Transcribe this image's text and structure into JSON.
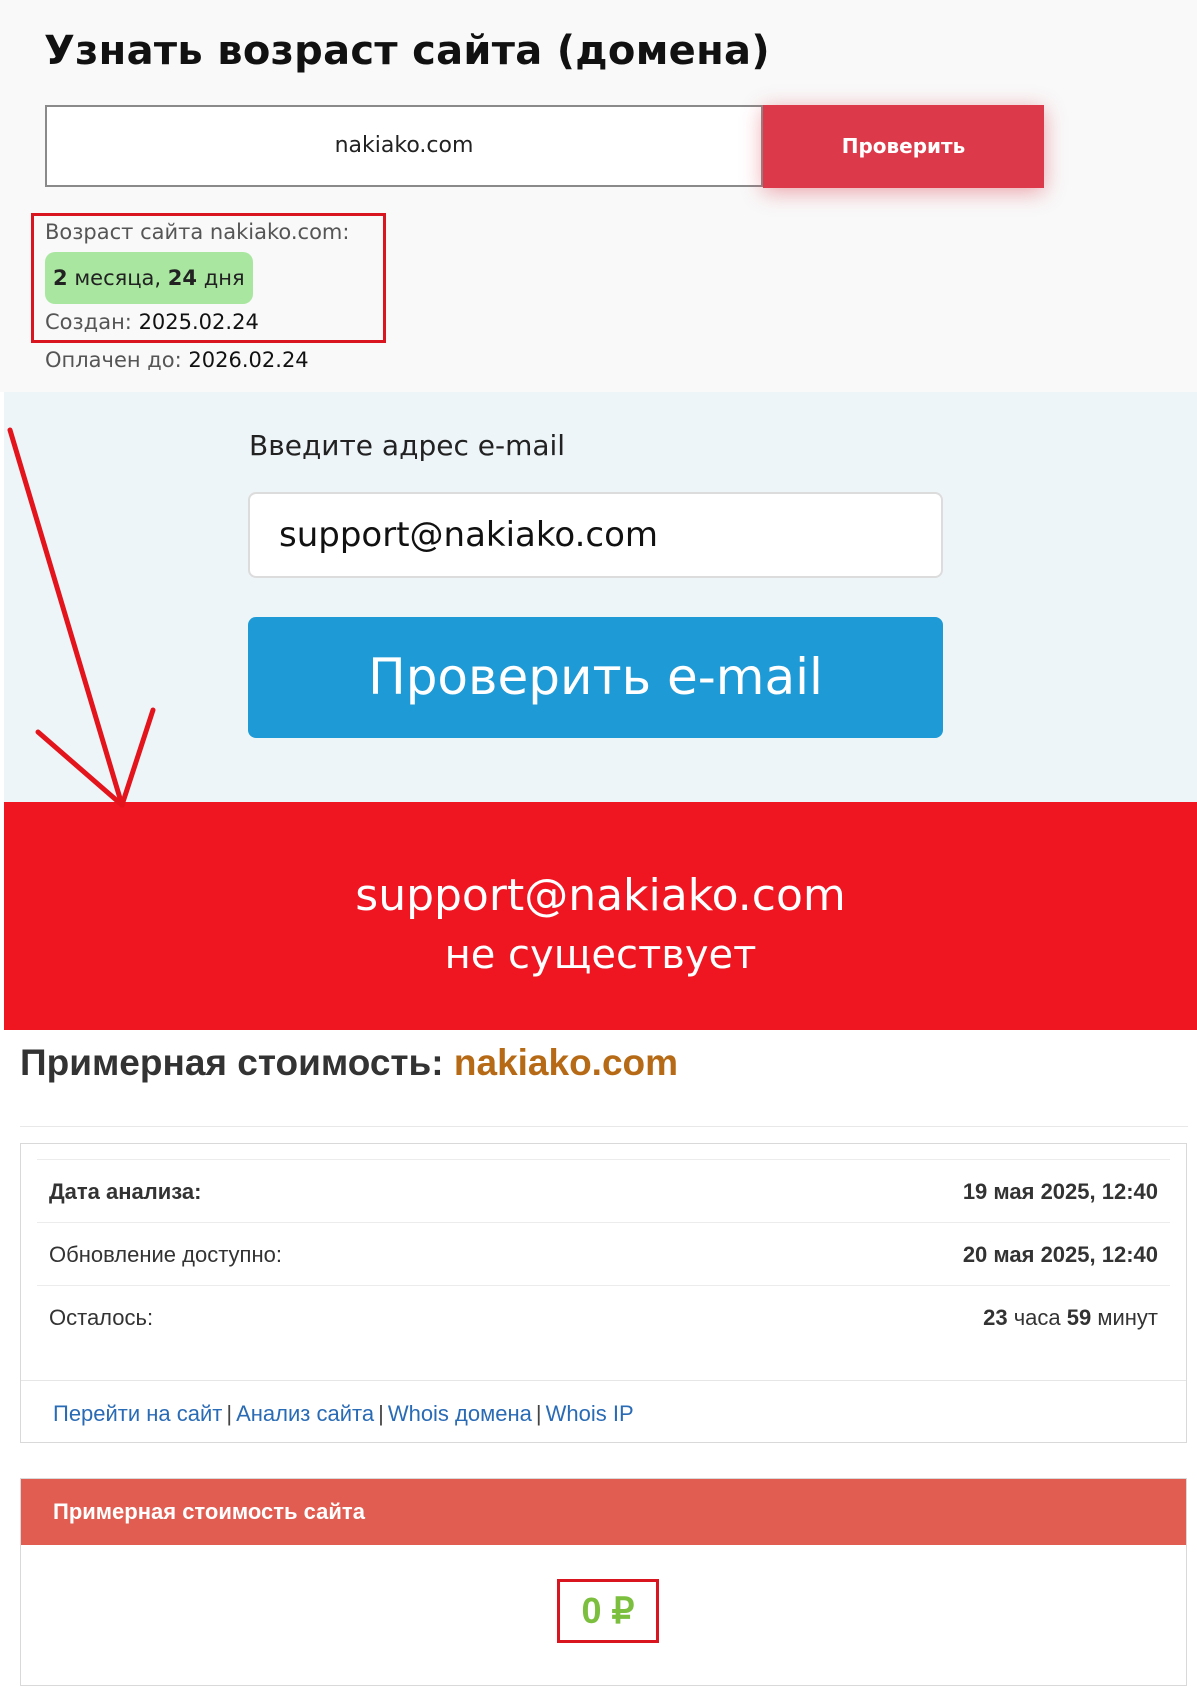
{
  "age_checker": {
    "title": "Узнать возраст сайта (домена)",
    "domain_value": "nakiako.com",
    "check_label": "Проверить",
    "result_label": "Возраст сайта nakiako.com:",
    "age_num1": "2",
    "age_word1": "месяца,",
    "age_num2": "24",
    "age_word2": "дня",
    "created_label": "Создан:",
    "created_value": "2025.02.24",
    "paid_label": "Оплачен до:",
    "paid_value": "2026.02.24",
    "badge_color": "#a9e7a0",
    "button_color": "#dc3a4a"
  },
  "email_checker": {
    "heading": "Введите адрес e-mail",
    "email_value": "support@nakiako.com",
    "button_label": "Проверить e-mail",
    "button_color": "#1e9ad6",
    "background": "#eef5f9"
  },
  "result_banner": {
    "email": "support@nakiako.com",
    "status": "не существует",
    "color": "#ef1521"
  },
  "price": {
    "title_prefix": "Примерная стоимость:",
    "title_domain": "nakiako.com",
    "rows": [
      {
        "label": "Дата анализа:",
        "value": "19 мая 2025, 12:40"
      },
      {
        "label": "Обновление доступно:",
        "value": "20 мая 2025, 12:40"
      },
      {
        "label": "Осталось:",
        "hours_num": "23",
        "hours_word": "часа",
        "minutes_num": "59",
        "minutes_word": "минут"
      }
    ],
    "links": [
      "Перейти на сайт",
      "Анализ сайта",
      "Whois домена",
      "Whois IP"
    ],
    "link_separator": "|",
    "value_header": "Примерная стоимость сайта",
    "value_amount": "0 ₽",
    "header_color": "#e25d51",
    "amount_color": "#7cbf3f"
  }
}
